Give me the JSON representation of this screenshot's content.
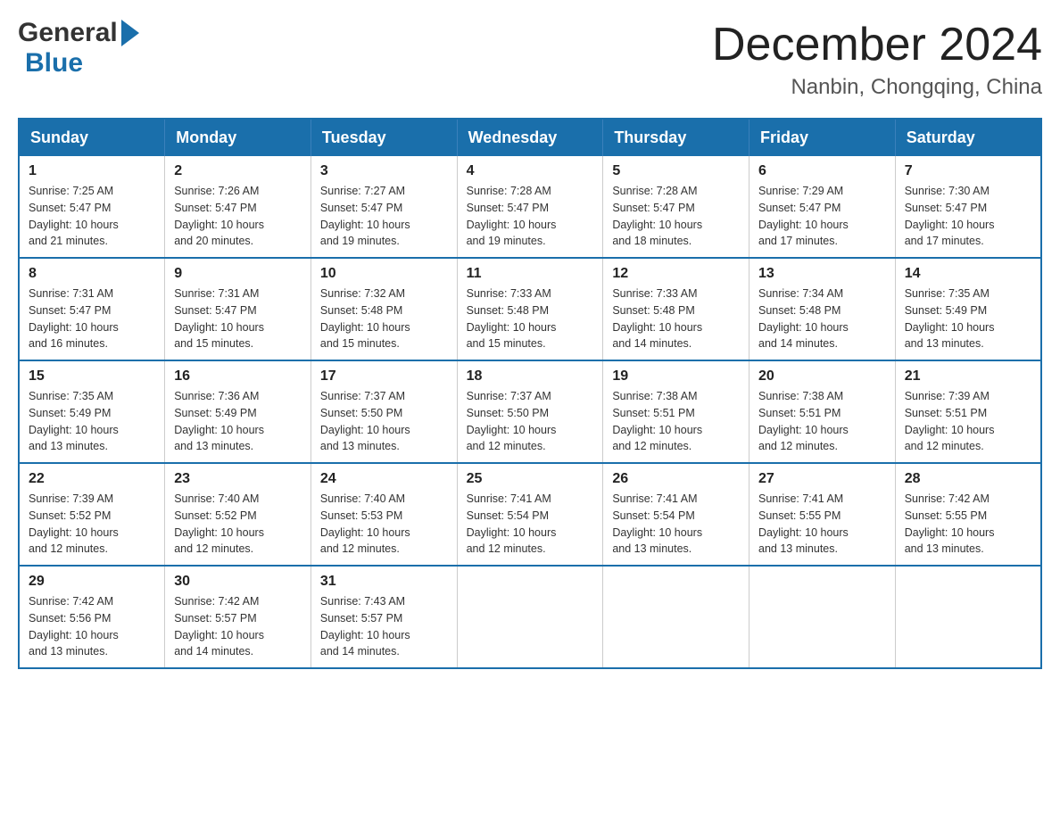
{
  "header": {
    "logo": {
      "general": "General",
      "blue": "Blue"
    },
    "title": "December 2024",
    "location": "Nanbin, Chongqing, China"
  },
  "days_of_week": [
    "Sunday",
    "Monday",
    "Tuesday",
    "Wednesday",
    "Thursday",
    "Friday",
    "Saturday"
  ],
  "weeks": [
    [
      {
        "day": "1",
        "sunrise": "7:25 AM",
        "sunset": "5:47 PM",
        "daylight": "10 hours and 21 minutes."
      },
      {
        "day": "2",
        "sunrise": "7:26 AM",
        "sunset": "5:47 PM",
        "daylight": "10 hours and 20 minutes."
      },
      {
        "day": "3",
        "sunrise": "7:27 AM",
        "sunset": "5:47 PM",
        "daylight": "10 hours and 19 minutes."
      },
      {
        "day": "4",
        "sunrise": "7:28 AM",
        "sunset": "5:47 PM",
        "daylight": "10 hours and 19 minutes."
      },
      {
        "day": "5",
        "sunrise": "7:28 AM",
        "sunset": "5:47 PM",
        "daylight": "10 hours and 18 minutes."
      },
      {
        "day": "6",
        "sunrise": "7:29 AM",
        "sunset": "5:47 PM",
        "daylight": "10 hours and 17 minutes."
      },
      {
        "day": "7",
        "sunrise": "7:30 AM",
        "sunset": "5:47 PM",
        "daylight": "10 hours and 17 minutes."
      }
    ],
    [
      {
        "day": "8",
        "sunrise": "7:31 AM",
        "sunset": "5:47 PM",
        "daylight": "10 hours and 16 minutes."
      },
      {
        "day": "9",
        "sunrise": "7:31 AM",
        "sunset": "5:47 PM",
        "daylight": "10 hours and 15 minutes."
      },
      {
        "day": "10",
        "sunrise": "7:32 AM",
        "sunset": "5:48 PM",
        "daylight": "10 hours and 15 minutes."
      },
      {
        "day": "11",
        "sunrise": "7:33 AM",
        "sunset": "5:48 PM",
        "daylight": "10 hours and 15 minutes."
      },
      {
        "day": "12",
        "sunrise": "7:33 AM",
        "sunset": "5:48 PM",
        "daylight": "10 hours and 14 minutes."
      },
      {
        "day": "13",
        "sunrise": "7:34 AM",
        "sunset": "5:48 PM",
        "daylight": "10 hours and 14 minutes."
      },
      {
        "day": "14",
        "sunrise": "7:35 AM",
        "sunset": "5:49 PM",
        "daylight": "10 hours and 13 minutes."
      }
    ],
    [
      {
        "day": "15",
        "sunrise": "7:35 AM",
        "sunset": "5:49 PM",
        "daylight": "10 hours and 13 minutes."
      },
      {
        "day": "16",
        "sunrise": "7:36 AM",
        "sunset": "5:49 PM",
        "daylight": "10 hours and 13 minutes."
      },
      {
        "day": "17",
        "sunrise": "7:37 AM",
        "sunset": "5:50 PM",
        "daylight": "10 hours and 13 minutes."
      },
      {
        "day": "18",
        "sunrise": "7:37 AM",
        "sunset": "5:50 PM",
        "daylight": "10 hours and 12 minutes."
      },
      {
        "day": "19",
        "sunrise": "7:38 AM",
        "sunset": "5:51 PM",
        "daylight": "10 hours and 12 minutes."
      },
      {
        "day": "20",
        "sunrise": "7:38 AM",
        "sunset": "5:51 PM",
        "daylight": "10 hours and 12 minutes."
      },
      {
        "day": "21",
        "sunrise": "7:39 AM",
        "sunset": "5:51 PM",
        "daylight": "10 hours and 12 minutes."
      }
    ],
    [
      {
        "day": "22",
        "sunrise": "7:39 AM",
        "sunset": "5:52 PM",
        "daylight": "10 hours and 12 minutes."
      },
      {
        "day": "23",
        "sunrise": "7:40 AM",
        "sunset": "5:52 PM",
        "daylight": "10 hours and 12 minutes."
      },
      {
        "day": "24",
        "sunrise": "7:40 AM",
        "sunset": "5:53 PM",
        "daylight": "10 hours and 12 minutes."
      },
      {
        "day": "25",
        "sunrise": "7:41 AM",
        "sunset": "5:54 PM",
        "daylight": "10 hours and 12 minutes."
      },
      {
        "day": "26",
        "sunrise": "7:41 AM",
        "sunset": "5:54 PM",
        "daylight": "10 hours and 13 minutes."
      },
      {
        "day": "27",
        "sunrise": "7:41 AM",
        "sunset": "5:55 PM",
        "daylight": "10 hours and 13 minutes."
      },
      {
        "day": "28",
        "sunrise": "7:42 AM",
        "sunset": "5:55 PM",
        "daylight": "10 hours and 13 minutes."
      }
    ],
    [
      {
        "day": "29",
        "sunrise": "7:42 AM",
        "sunset": "5:56 PM",
        "daylight": "10 hours and 13 minutes."
      },
      {
        "day": "30",
        "sunrise": "7:42 AM",
        "sunset": "5:57 PM",
        "daylight": "10 hours and 14 minutes."
      },
      {
        "day": "31",
        "sunrise": "7:43 AM",
        "sunset": "5:57 PM",
        "daylight": "10 hours and 14 minutes."
      },
      null,
      null,
      null,
      null
    ]
  ],
  "labels": {
    "sunrise": "Sunrise:",
    "sunset": "Sunset:",
    "daylight": "Daylight:"
  }
}
